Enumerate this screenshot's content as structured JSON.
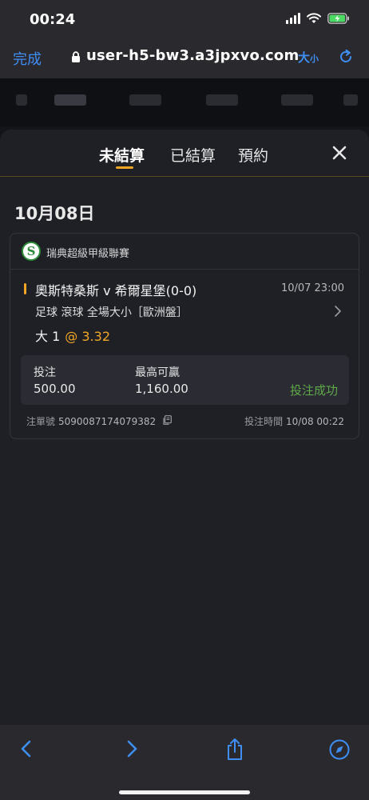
{
  "status_bar": {
    "time": "00:24"
  },
  "browser": {
    "done_label": "完成",
    "url": "user-h5-bw3.a3jpxvo.com",
    "text_size_large": "大",
    "text_size_small": "小"
  },
  "tabs": [
    {
      "label": "未結算",
      "active": true
    },
    {
      "label": "已結算",
      "active": false
    },
    {
      "label": "預約",
      "active": false
    }
  ],
  "date_title": "10月08日",
  "bet": {
    "league": "瑞典超級甲級聯賽",
    "league_logo_letter": "S",
    "match": "奧斯特桑斯 v 希爾星堡(0-0)",
    "match_time": "10/07 23:00",
    "market": "足球 滾球  全場大小［歐洲盤］",
    "selection": "大 1",
    "odds": "@ 3.32",
    "stake_label": "投注",
    "stake_value": "500.00",
    "max_win_label": "最高可贏",
    "max_win_value": "1,160.00",
    "status": "投注成功",
    "ticket_label": "注單號",
    "ticket_id": "5090087174079382",
    "bet_time_label": "投注時間",
    "bet_time": "10/08 00:22"
  },
  "colors": {
    "accent": "#f0a624",
    "success": "#5fa84a",
    "ios_blue": "#3f8ef5",
    "sheet_bg": "#1f2026"
  }
}
